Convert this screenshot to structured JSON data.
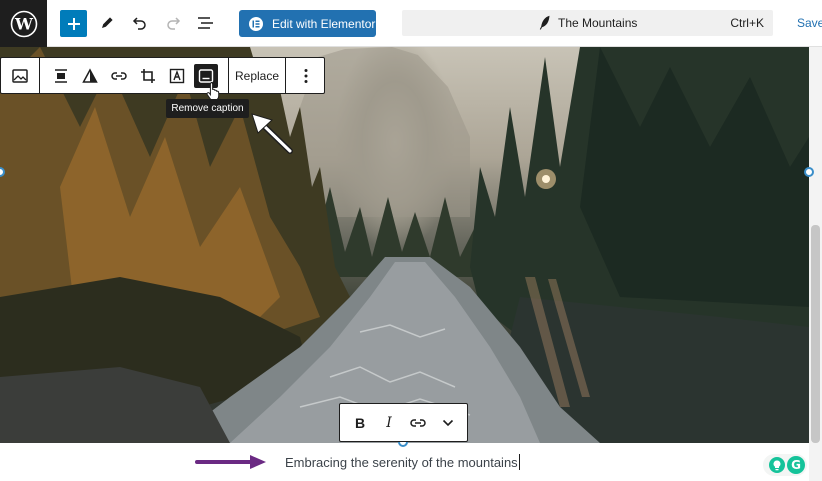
{
  "topbar": {
    "edit_with_elementor_label": "Edit with Elementor",
    "document_title": "The Mountains",
    "command_shortcut": "Ctrl+K",
    "save_label": "Save",
    "icons": {
      "logo": "wordpress-logo-icon",
      "add": "plus-icon",
      "tools": "pencil-icon",
      "undo": "undo-icon",
      "redo": "redo-icon",
      "outline": "list-view-icon",
      "title": "feather-icon"
    }
  },
  "block_toolbar": {
    "replace_label": "Replace",
    "active_tool": "caption",
    "tools": [
      "image-icon",
      "align-icon",
      "duotone-icon",
      "link-icon",
      "crop-icon",
      "text-overlay-icon",
      "caption-icon",
      "more-options-icon"
    ]
  },
  "tooltip": {
    "text": "Remove caption"
  },
  "caption": {
    "text": "Embracing the serenity of the mountains",
    "format_tools": {
      "bold": "B",
      "italic": "I"
    }
  },
  "colors": {
    "accent": "#007cba",
    "elementor": "#2271b1",
    "toolbar_border": "#1e1e1e",
    "annotation_arrow": "#6b2a83",
    "grammarly": "#15c39a"
  }
}
